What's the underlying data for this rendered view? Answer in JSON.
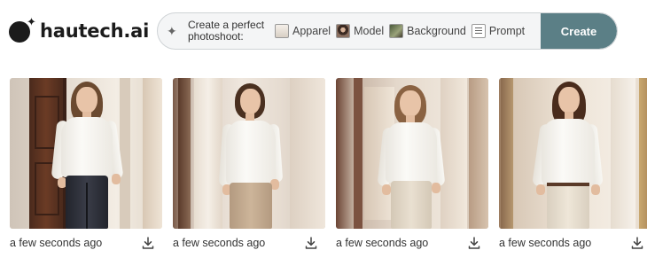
{
  "brand": {
    "name": "hautech.ai"
  },
  "prompt_bar": {
    "label": "Create a perfect photoshoot:",
    "chips": [
      {
        "label": "Apparel",
        "icon": "apparel-thumbnail"
      },
      {
        "label": "Model",
        "icon": "model-thumbnail"
      },
      {
        "label": "Background",
        "icon": "background-thumbnail"
      },
      {
        "label": "Prompt",
        "icon": "prompt-icon"
      }
    ],
    "create_label": "Create",
    "accent": "#5b7f86"
  },
  "gallery": {
    "items": [
      {
        "caption": "a few seconds ago",
        "pants": "dark navy",
        "setting": "wooden door"
      },
      {
        "caption": "a few seconds ago",
        "pants": "beige",
        "setting": "window curtains"
      },
      {
        "caption": "a few seconds ago",
        "pants": "cream",
        "setting": "doorway"
      },
      {
        "caption": "a few seconds ago",
        "pants": "cream with brown belt",
        "setting": "ornate wall"
      }
    ]
  }
}
